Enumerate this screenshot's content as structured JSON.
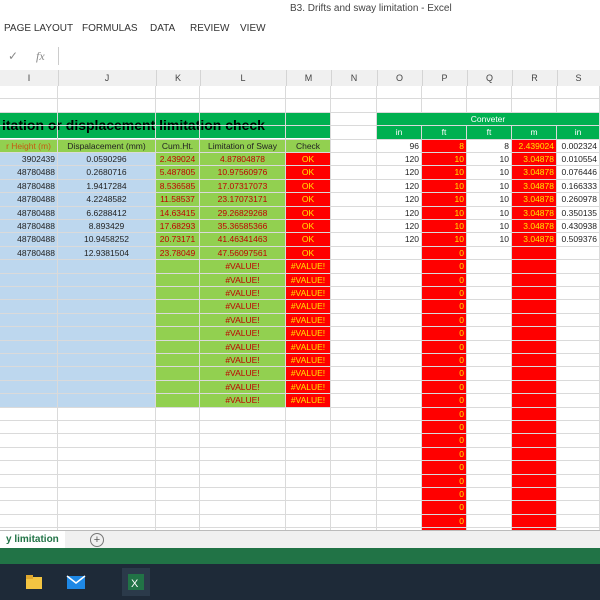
{
  "window": {
    "title": "B3. Drifts and sway limitation - Excel"
  },
  "ribbon": {
    "tabs": [
      "PAGE LAYOUT",
      "FORMULAS",
      "DATA",
      "REVIEW",
      "VIEW"
    ]
  },
  "formula_bar": {
    "fx": "fx",
    "check": "✓"
  },
  "columns": [
    "I",
    "J",
    "K",
    "L",
    "M",
    "N",
    "O",
    "P",
    "Q",
    "R",
    "S"
  ],
  "table": {
    "title": "itation or displacement limitation check",
    "headers": {
      "height": "r Height (m)",
      "displacement": "Dispalacement (mm)",
      "cumht": "Cum.Ht.",
      "limitation": "Limitation of Sway",
      "check": "Check"
    },
    "rows": [
      [
        "3902439",
        "0.0590296",
        "2.439024",
        "4.87804878",
        "OK"
      ],
      [
        "48780488",
        "0.2680716",
        "5.487805",
        "10.97560976",
        "OK"
      ],
      [
        "48780488",
        "1.9417284",
        "8.536585",
        "17.07317073",
        "OK"
      ],
      [
        "48780488",
        "4.2248582",
        "11.58537",
        "23.17073171",
        "OK"
      ],
      [
        "48780488",
        "6.6288412",
        "14.63415",
        "29.26829268",
        "OK"
      ],
      [
        "48780488",
        "8.893429",
        "17.68293",
        "35.36585366",
        "OK"
      ],
      [
        "48780488",
        "10.9458252",
        "20.73171",
        "41.46341463",
        "OK"
      ],
      [
        "48780488",
        "12.9381504",
        "23.78049",
        "47.56097561",
        "OK"
      ]
    ],
    "error_value": "#VALUE!",
    "error_rows": 11
  },
  "converter": {
    "title": "Conveter",
    "headers": [
      "in",
      "ft",
      "ft",
      "m",
      "in"
    ],
    "rows": [
      [
        "96",
        "8",
        "8",
        "2.439024",
        "0.002324"
      ],
      [
        "120",
        "10",
        "10",
        "3.04878",
        "0.010554"
      ],
      [
        "120",
        "10",
        "10",
        "3.04878",
        "0.076446"
      ],
      [
        "120",
        "10",
        "10",
        "3.04878",
        "0.166333"
      ],
      [
        "120",
        "10",
        "10",
        "3.04878",
        "0.260978"
      ],
      [
        "120",
        "10",
        "10",
        "3.04878",
        "0.350135"
      ],
      [
        "120",
        "10",
        "10",
        "3.04878",
        "0.430938"
      ],
      [
        "120",
        "10",
        "10",
        "3.04878",
        "0.509376"
      ]
    ],
    "zero": "0",
    "zero_rows": 22
  },
  "sheet": {
    "active_tab": "y limitation",
    "add": "+"
  },
  "taskbar": {
    "apps": [
      "file-explorer-icon",
      "mail-icon",
      "excel-icon"
    ]
  }
}
